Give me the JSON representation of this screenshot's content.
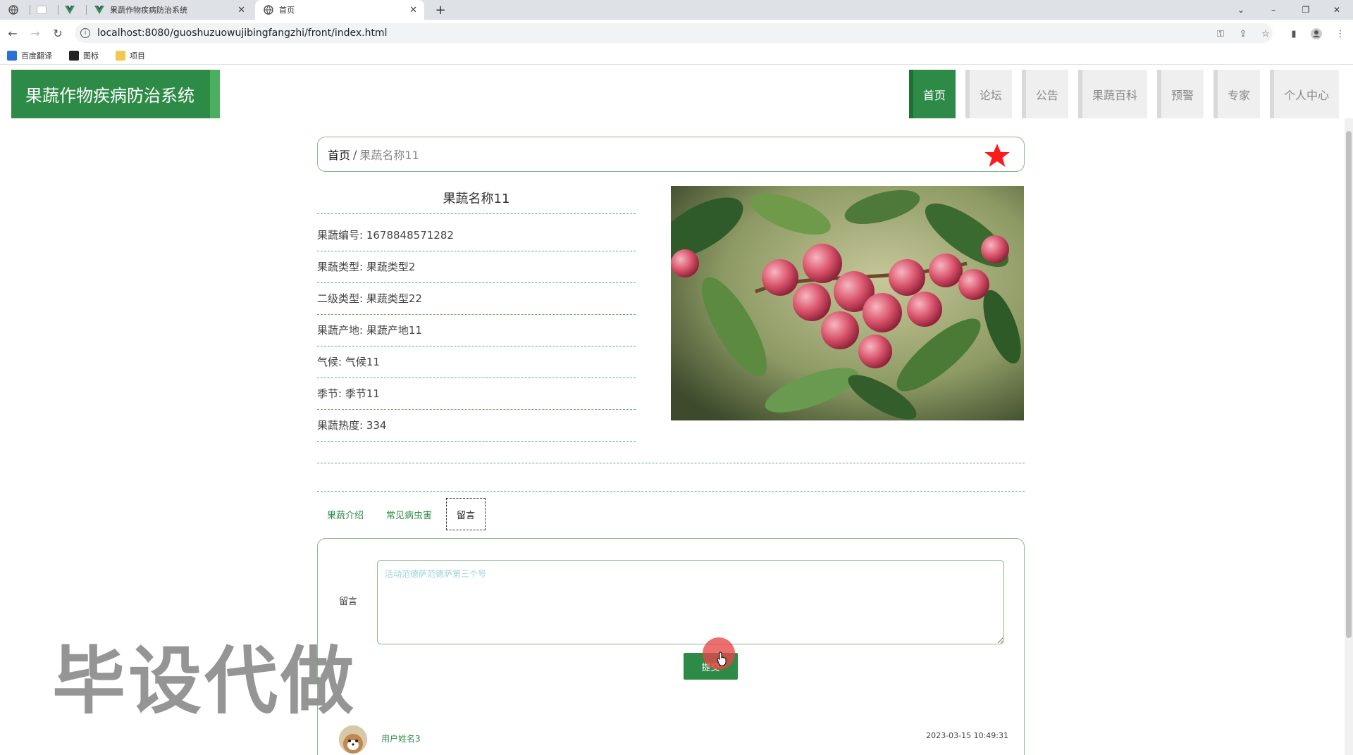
{
  "browser": {
    "tabs": [
      {
        "title": "",
        "icon": "globe-icon"
      },
      {
        "title": "",
        "icon": "blank-page-icon"
      },
      {
        "title": "",
        "icon": "vue-logo-icon"
      },
      {
        "title": "果蔬作物疾病防治系统",
        "icon": "vue-logo-icon"
      },
      {
        "title": "首页",
        "icon": "globe-icon"
      }
    ],
    "url": "localhost:8080/guoshuzuowujibingfangzhi/front/index.html",
    "bookmarks": [
      {
        "label": "百度翻译",
        "color": "#2a6fdb"
      },
      {
        "label": "图标",
        "color": "#222222"
      },
      {
        "label": "项目",
        "color": "#f2c94c"
      }
    ]
  },
  "site": {
    "title": "果蔬作物疾病防治系统",
    "nav": [
      "首页",
      "论坛",
      "公告",
      "果蔬百科",
      "预警",
      "专家",
      "个人中心"
    ],
    "active_nav": "首页",
    "brand_color": "#2e8b47"
  },
  "breadcrumb": {
    "home": "首页",
    "separator": "/",
    "current": "果蔬名称11"
  },
  "detail": {
    "title": "果蔬名称11",
    "fields": [
      {
        "label": "果蔬编号:",
        "value": "1678848571282"
      },
      {
        "label": "果蔬类型:",
        "value": "果蔬类型2"
      },
      {
        "label": "二级类型:",
        "value": "果蔬类型22"
      },
      {
        "label": "果蔬产地:",
        "value": "果蔬产地11"
      },
      {
        "label": "气候:",
        "value": "气候11"
      },
      {
        "label": "季节:",
        "value": "季节11"
      },
      {
        "label": "果蔬热度:",
        "value": "334"
      }
    ]
  },
  "tabs": [
    "果蔬介绍",
    "常见病虫害",
    "留言"
  ],
  "active_tab": "留言",
  "comment_form": {
    "label": "留言",
    "placeholder": "活动范德萨范德萨第三个号",
    "submit": "提交"
  },
  "comments": [
    {
      "user": "用户姓名3",
      "time": "2023-03-15 10:49:31"
    }
  ],
  "watermark": "毕设代做"
}
